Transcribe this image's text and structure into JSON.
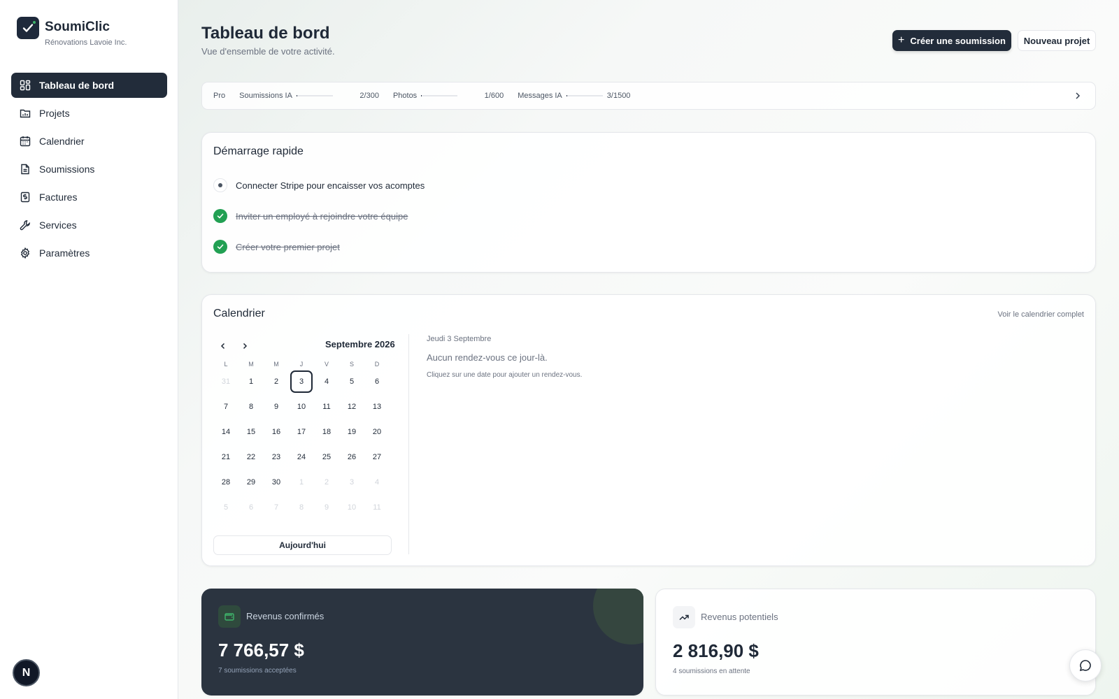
{
  "brand": {
    "name": "SoumiClic",
    "company": "Rénovations Lavoie Inc."
  },
  "sidebar": {
    "items": [
      {
        "label": "Tableau de bord",
        "icon": "dashboard-icon",
        "active": true
      },
      {
        "label": "Projets",
        "icon": "folder-icon"
      },
      {
        "label": "Calendrier",
        "icon": "calendar-icon"
      },
      {
        "label": "Soumissions",
        "icon": "document-icon"
      },
      {
        "label": "Factures",
        "icon": "invoice-icon"
      },
      {
        "label": "Services",
        "icon": "wrench-icon"
      },
      {
        "label": "Paramètres",
        "icon": "gear-icon"
      }
    ],
    "avatar_letter": "N"
  },
  "header": {
    "title": "Tableau de bord",
    "subtitle": "Vue d'ensemble de votre activité.",
    "primary_button": "Créer une soumission",
    "secondary_button": "Nouveau projet"
  },
  "usage": {
    "plan": "Pro",
    "metrics": [
      {
        "label": "Soumissions IA",
        "value": "2/300",
        "fraction": 0.0067
      },
      {
        "label": "Photos",
        "value": "1/600",
        "fraction": 0.0017
      },
      {
        "label": "Messages IA",
        "value": "3/1500",
        "fraction": 0.002
      }
    ]
  },
  "quick_start": {
    "title": "Démarrage rapide",
    "items": [
      {
        "label": "Connecter Stripe pour encaisser vos acomptes",
        "done": false
      },
      {
        "label": "Inviter un employé à rejoindre votre équipe",
        "done": true
      },
      {
        "label": "Créer votre premier projet",
        "done": true
      }
    ]
  },
  "calendar": {
    "title": "Calendrier",
    "full_link": "Voir le calendrier complet",
    "month": "Septembre 2026",
    "weekdays": [
      "L",
      "M",
      "M",
      "J",
      "V",
      "S",
      "D"
    ],
    "weeks": [
      [
        "31",
        "1",
        "2",
        "3",
        "4",
        "5",
        "6"
      ],
      [
        "7",
        "8",
        "9",
        "10",
        "11",
        "12",
        "13"
      ],
      [
        "14",
        "15",
        "16",
        "17",
        "18",
        "19",
        "20"
      ],
      [
        "21",
        "22",
        "23",
        "24",
        "25",
        "26",
        "27"
      ],
      [
        "28",
        "29",
        "30",
        "1",
        "2",
        "3",
        "4"
      ],
      [
        "5",
        "6",
        "7",
        "8",
        "9",
        "10",
        "11"
      ]
    ],
    "selected_day": "3",
    "today_button": "Aujourd'hui",
    "selected_date_label": "Jeudi 3 Septembre",
    "empty_message": "Aucun rendez-vous ce jour-là.",
    "hint": "Cliquez sur une date pour ajouter un rendez-vous."
  },
  "revenue": {
    "confirmed": {
      "label": "Revenus confirmés",
      "amount": "7 766,57 $",
      "sub": "7 soumissions acceptées"
    },
    "potential": {
      "label": "Revenus potentiels",
      "amount": "2 816,90 $",
      "sub": "4 soumissions en attente"
    }
  },
  "colors": {
    "primary": "#222c3a",
    "success": "#22a053",
    "accent_green": "#3fb56b"
  }
}
